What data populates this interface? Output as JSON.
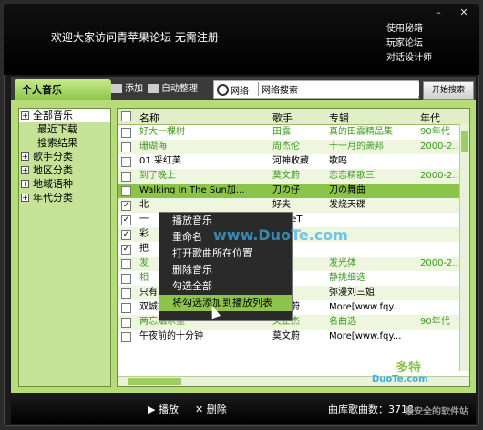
{
  "window": {
    "close_glyph": "✕",
    "minimize_glyph": "–"
  },
  "banner": "欢迎大家访问青苹果论坛 无需注册",
  "top_links": [
    "使用秘籍",
    "玩家论坛",
    "对话设计师"
  ],
  "tabs": {
    "personal_music": "个人音乐",
    "add_label": "添加",
    "organize_label": "自动整理"
  },
  "search": {
    "scope": "网络",
    "value": "网络搜索",
    "button": "开始搜索"
  },
  "tree": [
    {
      "label": "全部音乐",
      "level": 0,
      "expandable": true,
      "selected": true
    },
    {
      "label": "最近下载",
      "level": 1
    },
    {
      "label": "搜索结果",
      "level": 1
    },
    {
      "label": "歌手分类",
      "level": 0,
      "expandable": true
    },
    {
      "label": "地区分类",
      "level": 0,
      "expandable": true
    },
    {
      "label": "地域语种",
      "level": 0,
      "expandable": true
    },
    {
      "label": "年代分类",
      "level": 0,
      "expandable": true
    }
  ],
  "table": {
    "headers": {
      "name": "名称",
      "artist": "歌手",
      "album": "专辑",
      "era": "年代"
    },
    "rows": [
      {
        "name": "好大一棵树",
        "artist": "田震",
        "album": "真的田震精品集",
        "era": "90年代",
        "checked": false,
        "green": true
      },
      {
        "name": "珊瑚海",
        "artist": "周杰伦",
        "album": "十一月的萧邦",
        "era": "2000-2...",
        "checked": false,
        "green": true
      },
      {
        "name": "01.采红芙",
        "artist": "河神收藏",
        "album": "歌鸣",
        "era": "",
        "checked": false,
        "green": false
      },
      {
        "name": "到了晚上",
        "artist": "莫文蔚",
        "album": "恋恋精歌三",
        "era": "2000-2...",
        "checked": false,
        "green": true
      },
      {
        "name": "Walking In The Sun加...",
        "artist": "刀の仔",
        "album": "刀の舞曲",
        "era": "",
        "checked": false,
        "green": false,
        "selected": true
      },
      {
        "name": "北",
        "artist": "好夫",
        "album": "发烧天碟",
        "era": "",
        "checked": true,
        "green": false
      },
      {
        "name": "一",
        "artist": "....NeT",
        "album": "",
        "era": "",
        "checked": true,
        "green": false
      },
      {
        "name": "彩",
        "artist": "",
        "album": "",
        "era": "",
        "checked": true,
        "green": false
      },
      {
        "name": "把",
        "artist": "",
        "album": "",
        "era": "",
        "checked": true,
        "green": false
      },
      {
        "name": "发",
        "artist": "",
        "album": "发光体",
        "era": "2000-2...",
        "checked": false,
        "green": true
      },
      {
        "name": "相",
        "artist": "",
        "album": "静挑细选",
        "era": "",
        "checked": false,
        "green": true
      },
      {
        "name": "只有山歌敬亲人(完整版)",
        "artist": "敬干",
        "album": "弥漫刘三姐",
        "era": "",
        "checked": false,
        "green": false
      },
      {
        "name": "双城故事",
        "artist": "莫文蔚",
        "album": "More[www.fqy...",
        "era": "",
        "checked": false,
        "green": false
      },
      {
        "name": "两忘烟水里",
        "artist": "关正杰",
        "album": "名曲选",
        "era": "90年代",
        "checked": false,
        "green": true
      },
      {
        "name": "午夜前的十分钟",
        "artist": "莫文蔚",
        "album": "More[www.fqy...",
        "era": "",
        "checked": false,
        "green": false
      }
    ]
  },
  "context_menu": [
    "播放音乐",
    "重命名",
    "打开歌曲所在位置",
    "删除音乐",
    "勾选全部",
    "将勾选添加到播放列表"
  ],
  "bottom": {
    "play": "播放",
    "delete": "删除",
    "count": "曲库歌曲数：3718"
  },
  "watermarks": [
    "www.DuoTe.com",
    "多特",
    "DuoTe.com",
    "最安全的软件站"
  ]
}
